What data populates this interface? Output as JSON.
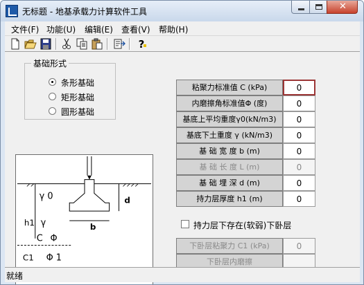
{
  "window": {
    "title": "无标题 - 地基承载力计算软件工具",
    "app_icon": "app-building-icon",
    "controls": [
      "minimize-icon",
      "maximize-icon",
      "close-icon"
    ]
  },
  "menu": [
    "文件(F)",
    "功能(U)",
    "编辑(E)",
    "查看(V)",
    "帮助(H)"
  ],
  "toolbar": [
    "new-icon",
    "open-icon",
    "save-icon",
    "cut-icon",
    "copy-icon",
    "paste-icon",
    "export-icon",
    "help-icon"
  ],
  "foundation": {
    "legend": "基础形式",
    "options": [
      {
        "label": "条形基础",
        "selected": true
      },
      {
        "label": "矩形基础",
        "selected": false
      },
      {
        "label": "圆形基础",
        "selected": false
      }
    ]
  },
  "diagram": {
    "labels": {
      "gamma0": "γ 0",
      "d": "d",
      "h1": "h1",
      "gamma": "γ",
      "b": "b",
      "c": "C",
      "phi": "Φ",
      "c1": "C1",
      "phi1": "Φ 1"
    }
  },
  "params": [
    {
      "label": "粘聚力标准值 C  (kPa)",
      "value": "0",
      "enabled": true,
      "active": true
    },
    {
      "label": "内磨擦角标准值Φ (度)",
      "value": "0",
      "enabled": true,
      "active": false
    },
    {
      "label": "基底上平均重度γ0(kN/m3)",
      "value": "0",
      "enabled": true,
      "active": false
    },
    {
      "label": "基底下土重度 γ (kN/m3)",
      "value": "0",
      "enabled": true,
      "active": false
    },
    {
      "label": "基 础 宽 度 b   (m)",
      "value": "0",
      "enabled": true,
      "active": false
    },
    {
      "label": "基 础 长 度 L   (m)",
      "value": "0",
      "enabled": false,
      "active": false
    },
    {
      "label": "基 础 埋 深 d   (m)",
      "value": "0",
      "enabled": true,
      "active": false
    },
    {
      "label": "持力层厚度 h1   (m)",
      "value": "0",
      "enabled": true,
      "active": false
    }
  ],
  "weak_layer": {
    "checkbox_label": "持力层下存在(软弱)下卧层",
    "checked": false,
    "params": [
      {
        "label": "下卧层粘聚力 C1 (kPa)",
        "value": "0"
      },
      {
        "label": "下卧层内磨擦",
        "value": ""
      }
    ]
  },
  "status": "就绪"
}
